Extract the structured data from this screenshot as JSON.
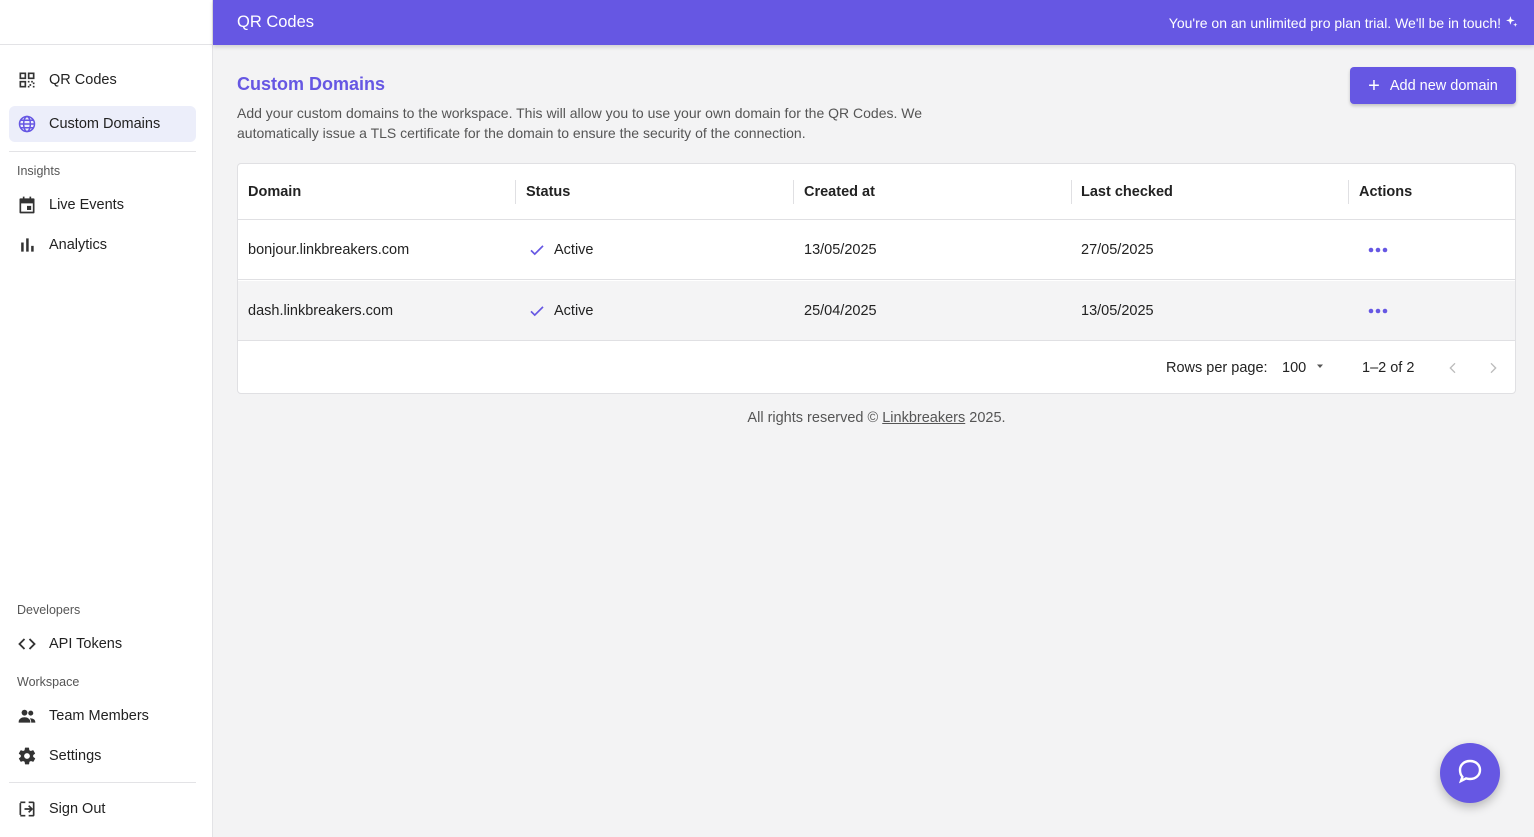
{
  "colors": {
    "accent": "#6657e3",
    "active_nav_bg": "#eceefa"
  },
  "sidebar": {
    "items": [
      {
        "label": "QR Codes",
        "icon": "qr-code-icon"
      },
      {
        "label": "Custom Domains",
        "icon": "globe-icon",
        "active": true
      }
    ],
    "insights_label": "Insights",
    "insights_items": [
      {
        "label": "Live Events",
        "icon": "calendar-icon"
      },
      {
        "label": "Analytics",
        "icon": "bar-chart-icon"
      }
    ],
    "developers_label": "Developers",
    "developers_items": [
      {
        "label": "API Tokens",
        "icon": "code-icon"
      }
    ],
    "workspace_label": "Workspace",
    "workspace_items": [
      {
        "label": "Team Members",
        "icon": "people-icon"
      },
      {
        "label": "Settings",
        "icon": "gear-icon"
      }
    ],
    "sign_out": {
      "label": "Sign Out",
      "icon": "sign-out-icon"
    }
  },
  "topbar": {
    "title": "QR Codes",
    "trial_message": "You're on an unlimited pro plan trial. We'll be in touch!",
    "trial_icon": "sparkle-icon"
  },
  "main": {
    "title": "Custom Domains",
    "description": "Add your custom domains to the workspace. This will allow you to use your own domain for the QR Codes. We automatically issue a TLS certificate for the domain to ensure the security of the connection.",
    "add_button_label": "Add new domain"
  },
  "table": {
    "columns": [
      "Domain",
      "Status",
      "Created at",
      "Last checked",
      "Actions"
    ],
    "rows": [
      {
        "domain": "bonjour.linkbreakers.com",
        "status": "Active",
        "created_at": "13/05/2025",
        "last_checked": "27/05/2025"
      },
      {
        "domain": "dash.linkbreakers.com",
        "status": "Active",
        "created_at": "25/04/2025",
        "last_checked": "13/05/2025"
      }
    ],
    "footer": {
      "rows_per_page_label": "Rows per page:",
      "rows_per_page_value": "100",
      "range": "1–2 of 2"
    }
  },
  "footer": {
    "prefix": "All rights reserved © ",
    "link": "Linkbreakers",
    "suffix": " 2025."
  }
}
